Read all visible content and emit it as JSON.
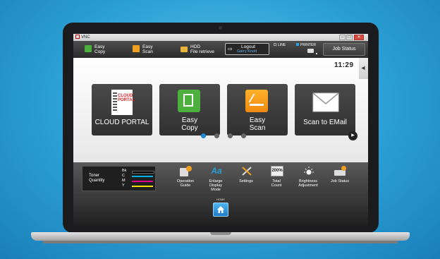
{
  "window": {
    "app_title": "VNC",
    "minimize_glyph": "–",
    "maximize_glyph": "□",
    "close_glyph": "✕"
  },
  "topbar": {
    "easy_copy": {
      "line1": "Easy",
      "line2": "Copy",
      "icon": "easy-copy-icon"
    },
    "easy_scan": {
      "line1": "Easy",
      "line2": "Scan",
      "icon": "easy-scan-icon"
    },
    "hdd": {
      "line1": "HDD",
      "line2": "File retrieve",
      "icon": "folder-icon"
    },
    "logout": {
      "label": "Logout",
      "user": "Garry Knott",
      "icon": "logout-icon",
      "glyph": "⇨"
    },
    "line_indicator": "LINE",
    "printer_indicator": "PRINTER",
    "job_status": "Job Status"
  },
  "main": {
    "clock": "11:29",
    "side_tab_glyph": "◀|",
    "tiles": [
      {
        "label": "CLOUD PORTAL",
        "icon": "cloud-portal-icon",
        "logo_line1": "CLOUD",
        "logo_line2": "PORTAL"
      },
      {
        "label_line1": "Easy",
        "label_line2": "Copy",
        "icon": "easy-copy-icon"
      },
      {
        "label_line1": "Easy",
        "label_line2": "Scan",
        "icon": "easy-scan-icon"
      },
      {
        "label": "Scan to EMail",
        "icon": "envelope-icon"
      }
    ],
    "page_count": 4,
    "current_page": 1,
    "next_glyph": "▶"
  },
  "status": {
    "toner_label_line1": "Toner",
    "toner_label_line2": "Quantity",
    "toner": [
      {
        "key": "Bk",
        "color": "#222222"
      },
      {
        "key": "C",
        "color": "#00b0e8"
      },
      {
        "key": "M",
        "color": "#e0008a"
      },
      {
        "key": "Y",
        "color": "#f2e000"
      }
    ],
    "items": [
      {
        "line1": "Operation",
        "line2": "Guide",
        "line3": "",
        "icon": "operation-guide-icon"
      },
      {
        "line1": "Enlarge",
        "line2": "Display",
        "line3": "Mode",
        "icon": "enlarge-display-icon"
      },
      {
        "line1": "Settings",
        "line2": "",
        "line3": "",
        "icon": "settings-icon"
      },
      {
        "line1": "Total",
        "line2": "Count",
        "line3": "",
        "icon": "total-count-icon"
      },
      {
        "line1": "Brightness",
        "line2": "Adjustment",
        "line3": "",
        "icon": "brightness-icon"
      },
      {
        "line1": "Job Status",
        "line2": "",
        "line3": "",
        "icon": "job-status-icon"
      }
    ],
    "total_count_glyph": "200%"
  },
  "bottom": {
    "home_label": "HOME",
    "home_icon": "home-icon"
  },
  "colors": {
    "accent": "#1e88d6",
    "tile": "#3a3a3a",
    "bar": "#2c2c2c"
  }
}
